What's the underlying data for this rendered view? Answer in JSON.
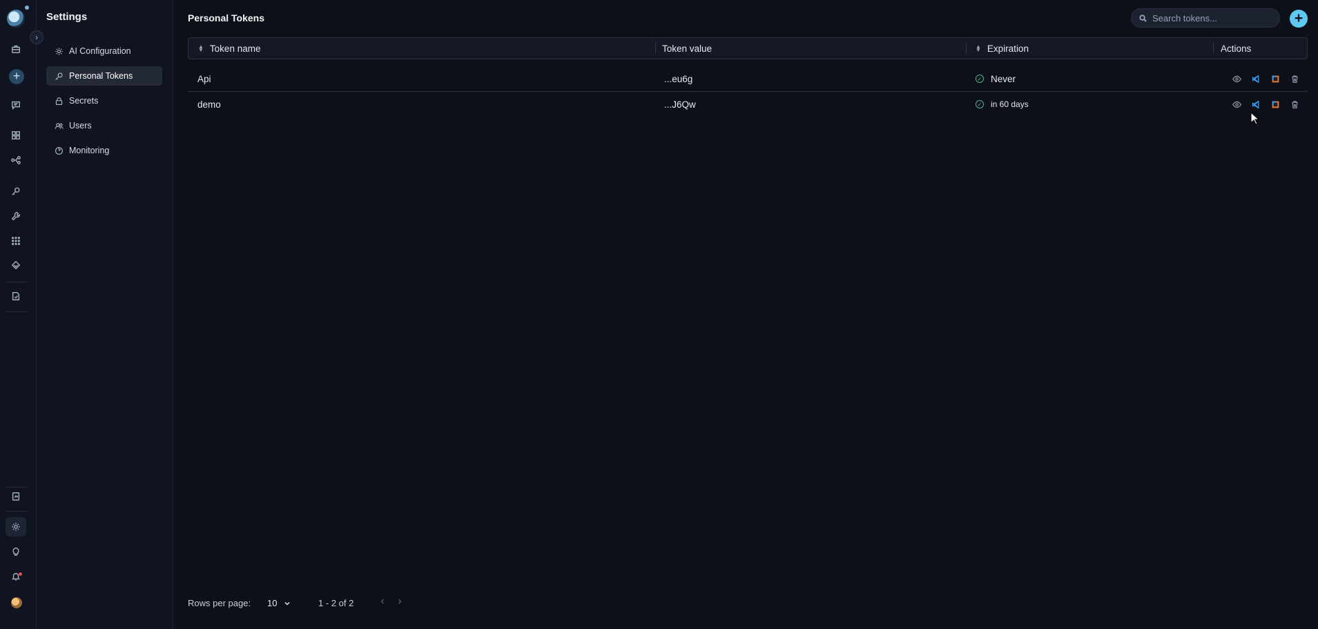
{
  "sidebar": {
    "title": "Settings",
    "items": [
      {
        "label": "AI Configuration",
        "icon": "gear-icon"
      },
      {
        "label": "Personal Tokens",
        "icon": "key-icon",
        "active": true
      },
      {
        "label": "Secrets",
        "icon": "lock-icon"
      },
      {
        "label": "Users",
        "icon": "users-icon"
      },
      {
        "label": "Monitoring",
        "icon": "monitoring-icon"
      }
    ]
  },
  "header": {
    "title": "Personal Tokens",
    "search_placeholder": "Search tokens...",
    "add_label": "+"
  },
  "table": {
    "columns": [
      "Token name",
      "Token value",
      "Expiration",
      "Actions"
    ],
    "rows": [
      {
        "name": "Api",
        "value": "...eu6g",
        "expiration": "Never"
      },
      {
        "name": "demo",
        "value": "...J6Qw",
        "expiration": "in 60 days"
      }
    ]
  },
  "footer": {
    "rows_per_page_label": "Rows per page:",
    "rows_per_page_value": "10",
    "range": "1 - 2 of 2"
  },
  "colors": {
    "background": "#0d1018",
    "accent": "#5ec8ef",
    "success": "#4fb58a",
    "vscode_blue": "#3b9ce8"
  }
}
